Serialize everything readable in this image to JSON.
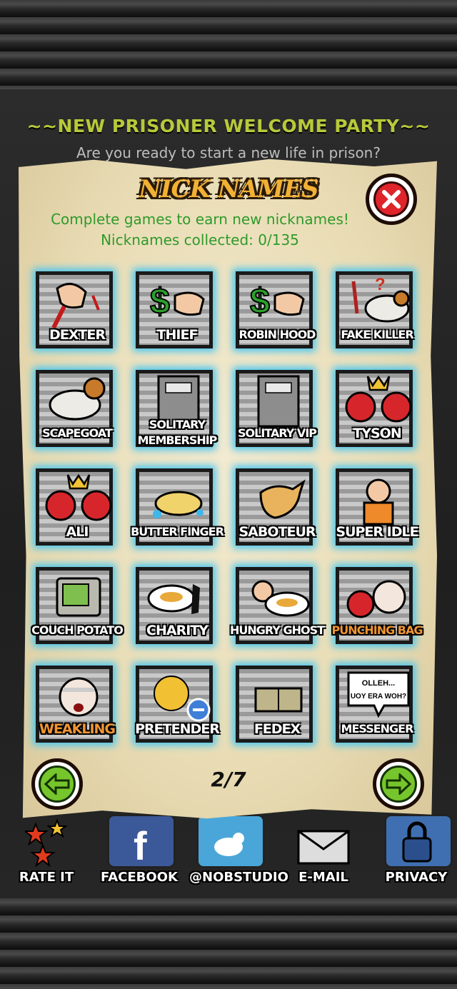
{
  "background": {
    "banner_title": "~~NEW PRISONER WELCOME PARTY~~",
    "banner_subtitle": "Are you ready to start a new life in prison?",
    "social": [
      {
        "label": "RATE IT",
        "icon": "stars-icon"
      },
      {
        "label": "FACEBOOK",
        "icon": "facebook-icon"
      },
      {
        "label": "@NOBSTUDIO",
        "icon": "twitter-icon"
      },
      {
        "label": "E-MAIL",
        "icon": "envelope-icon"
      },
      {
        "label": "PRIVACY",
        "icon": "padlock-icon"
      }
    ]
  },
  "dialog": {
    "title": "NICK NAMES",
    "subtitle": "Complete games to earn new nicknames!",
    "counter": "Nicknames collected: 0/135",
    "page_indicator": "2/7",
    "nicknames": [
      {
        "label": "DEXTER",
        "art": "knife-hand-icon"
      },
      {
        "label": "THIEF",
        "art": "money-hand-icon"
      },
      {
        "label": "ROBIN HOOD",
        "art": "money-hand-icon"
      },
      {
        "label": "FAKE KILLER",
        "art": "ram-knife-icon"
      },
      {
        "label": "SCAPEGOAT",
        "art": "ram-icon"
      },
      {
        "label": "SOLITARY MEMBERSHIP",
        "line1": "SOLITARY",
        "line2": "MEMBERSHIP",
        "art": "solitary-door-icon"
      },
      {
        "label": "SOLITARY VIP",
        "art": "solitary-door-icon"
      },
      {
        "label": "TYSON",
        "art": "boxing-gloves-crown-icon"
      },
      {
        "label": "ALI",
        "art": "boxing-gloves-crown-icon"
      },
      {
        "label": "BUTTER FINGER",
        "art": "soap-icon"
      },
      {
        "label": "SABOTEUR",
        "art": "pointing-fist-icon"
      },
      {
        "label": "SUPER IDLE",
        "art": "sleeping-prisoner-icon"
      },
      {
        "label": "COUCH POTATO",
        "art": "tv-icon"
      },
      {
        "label": "CHARITY",
        "art": "plate-silhouette-icon"
      },
      {
        "label": "HUNGRY GHOST",
        "art": "fist-plate-icon"
      },
      {
        "label": "PUNCHING BAG",
        "art": "bandaged-boxer-icon",
        "highlight": "orange"
      },
      {
        "label": "WEAKLING",
        "art": "bandaged-face-icon",
        "highlight": "orange"
      },
      {
        "label": "PRETENDER",
        "art": "food-minus-icon"
      },
      {
        "label": "FEDEX",
        "art": "package-icon"
      },
      {
        "label": "MESSENGER",
        "art": "speech-bubble-icon",
        "bubble_line1": "OLLEH...",
        "bubble_line2": "UOY ERA WOH?"
      }
    ]
  },
  "colors": {
    "accent_green": "#2f9a2a",
    "title_orange": "#f2b134",
    "glow_blue": "#46c6f0",
    "close_red": "#e0242b",
    "nav_green": "#76c52c"
  }
}
